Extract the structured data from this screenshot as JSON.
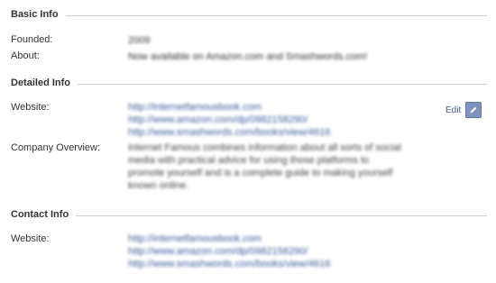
{
  "basic_info": {
    "title": "Basic Info",
    "founded_label": "Founded:",
    "founded_value": "2009",
    "about_label": "About:",
    "about_value": "Now available on Amazon.com and Smashwords.com!"
  },
  "detailed_info": {
    "title": "Detailed Info",
    "edit_label": "Edit",
    "website_label": "Website:",
    "websites": [
      "http://internetfamousbook.com",
      "http://www.amazon.com/dp/0982158290/",
      "http://www.smashwords.com/books/view/4616"
    ],
    "overview_label": "Company Overview:",
    "overview_lines": [
      "Internet Famous combines information about all sorts of social",
      "media with practical advice for using those platforms to",
      "promote yourself and is a complete guide to making yourself",
      "known online."
    ]
  },
  "contact_info": {
    "title": "Contact Info",
    "website_label": "Website:",
    "websites": [
      "http://internetfamousbook.com",
      "http://www.amazon.com/dp/0982158290/",
      "http://www.smashwords.com/books/view/4616"
    ]
  },
  "icons": {
    "edit": "pencil-icon"
  },
  "colors": {
    "link": "#3b5998",
    "rule": "#d0d0d0",
    "edit_button": "#7f93bc"
  }
}
